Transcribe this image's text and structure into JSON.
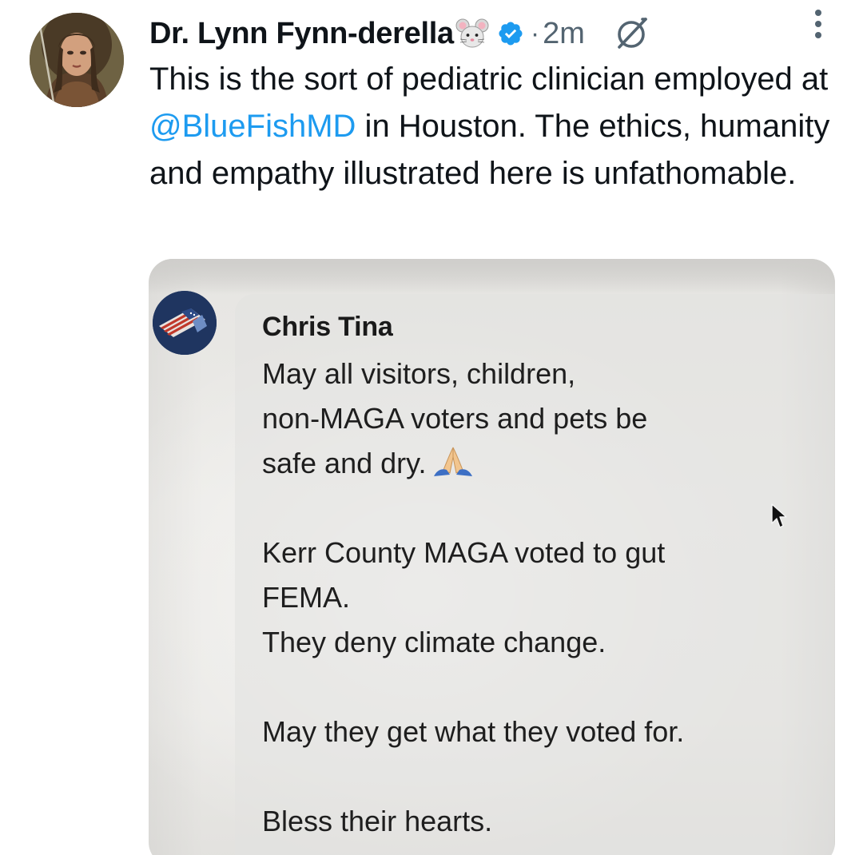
{
  "post": {
    "author": {
      "display_name": "Dr. Lynn Fynn-derella",
      "name_emoji": "mouse-face-emoji",
      "verified": true,
      "avatar": "woman-warrior-portrait"
    },
    "separator": "·",
    "timestamp": "2m",
    "grok_icon": "grok-icon",
    "more_icon": "more-vertical-icon",
    "text": {
      "before_mention": "This is the sort of pediatric clinician employed at ",
      "mention": "@BlueFishMD",
      "after_mention": " in Houston. The ethics, humanity and empathy illustrated here is unfathomable."
    }
  },
  "media": {
    "comment": {
      "author": "Chris Tina",
      "avatar": "american-flag-avatar",
      "lines": [
        "May all visitors, children,",
        "non-MAGA voters and pets be",
        "safe and dry."
      ],
      "emoji": "folded-hands-emoji",
      "paragraph2": [
        "Kerr County MAGA voted to gut",
        "FEMA.",
        "They deny climate change."
      ],
      "paragraph3": "May they get what they voted for.",
      "paragraph4": "Bless their hearts."
    },
    "cursor": "mouse-pointer-icon"
  },
  "colors": {
    "text": "#0f1419",
    "secondary": "#536471",
    "link": "#1d9bf0",
    "verified": "#1d9bf0"
  }
}
